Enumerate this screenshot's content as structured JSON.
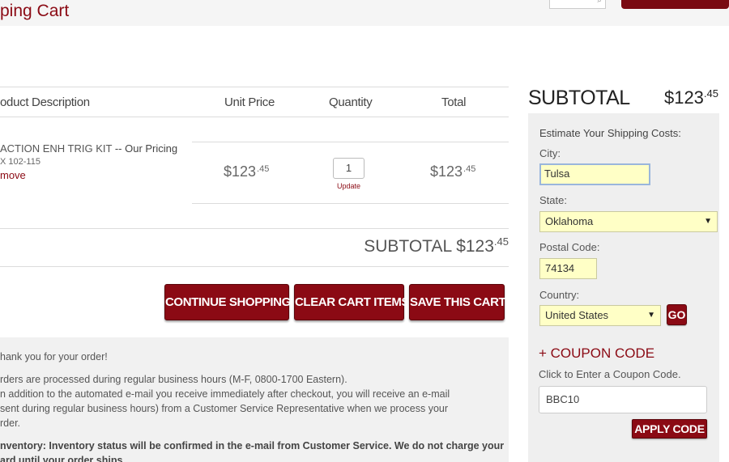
{
  "header": {
    "title": "ping Cart"
  },
  "cart": {
    "columns": {
      "description": "oduct Description",
      "unit_price": "Unit Price",
      "quantity": "Quantity",
      "total": "Total"
    },
    "item": {
      "name": "ACTION ENH TRIG KIT",
      "pricing_suffix": "-- Our Pricing",
      "sku": "X 102-115",
      "remove_label": "move",
      "unit_price_main": "$123",
      "unit_price_cents": ".45",
      "quantity": "1",
      "update_label": "Update",
      "total_main": "$123",
      "total_cents": ".45"
    },
    "subtotal_label": "SUBTOTAL $123",
    "subtotal_cents": ".45"
  },
  "actions": {
    "continue_label": "CONTINUE SHOPPING",
    "clear_label": "CLEAR CART ITEMS",
    "save_label": "SAVE THIS CART"
  },
  "notes": {
    "line1": "hank you for your order!",
    "line2": "rders are processed during regular business hours (M-F, 0800-1700 Eastern).",
    "line3": "n addition to the automated e-mail you receive immediately after checkout, you will receive an e-mail",
    "line4": "sent during regular business hours) from a Customer Service Representative when we process your",
    "line5": "rder.",
    "line6": "nventory: Inventory status will be confirmed in the e-mail from Customer Service. We do not charge your",
    "line7": "ard until your order ships."
  },
  "sidebar": {
    "subtotal_label": "SUBTOTAL",
    "subtotal_main": "$123",
    "subtotal_cents": ".45",
    "shipping_heading": "Estimate Your Shipping Costs:",
    "city_label": "City:",
    "city_value": "Tulsa",
    "state_label": "State:",
    "state_value": "Oklahoma",
    "postal_label": "Postal Code:",
    "postal_value": "74134",
    "country_label": "Country:",
    "country_value": "United States",
    "go_label": "GO",
    "coupon_heading": "+ COUPON CODE",
    "coupon_hint": "Click to Enter a Coupon Code.",
    "coupon_value": "BBC10",
    "apply_label": "APPLY CODE"
  },
  "colors": {
    "brand": "#8b0a14",
    "field_bg": "#ffffc6",
    "panel_bg": "#efefef"
  },
  "icons": {
    "dropdown": "chevron-down-icon",
    "search": "search-icon"
  }
}
